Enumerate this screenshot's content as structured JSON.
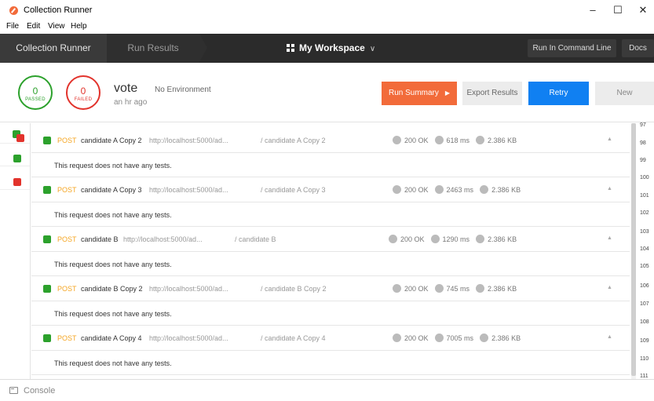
{
  "window": {
    "title": "Collection Runner",
    "minimize": "–",
    "maximize": "☐",
    "close": "✕"
  },
  "menu": [
    "File",
    "Edit",
    "View",
    "Help"
  ],
  "nav": {
    "tab1": "Collection Runner",
    "tab2": "Run Results",
    "workspace": "My Workspace",
    "workspace_chevron": "∨",
    "command_line": "Run In Command Line",
    "docs": "Docs"
  },
  "summary": {
    "passed_count": "0",
    "passed_label": "PASSED",
    "failed_count": "0",
    "failed_label": "FAILED",
    "run_name": "vote",
    "environment": "No Environment",
    "time_ago": "an hr ago"
  },
  "actions": {
    "run_summary": "Run Summary",
    "run_summary_arrow": "▶",
    "export": "Export Results",
    "retry": "Retry",
    "new": "New"
  },
  "requests": [
    {
      "method": "POST",
      "name": "candidate A Copy 2",
      "url": "http://localhost:5000/ad...",
      "path": "/ candidate A Copy 2",
      "status": "200 OK",
      "time": "618 ms",
      "size": "2.386 KB",
      "test_message": "This request does not have any tests."
    },
    {
      "method": "POST",
      "name": "candidate A Copy 3",
      "url": "http://localhost:5000/ad...",
      "path": "/ candidate A Copy 3",
      "status": "200 OK",
      "time": "2463 ms",
      "size": "2.386 KB",
      "test_message": "This request does not have any tests."
    },
    {
      "method": "POST",
      "name": "candidate B",
      "url": "http://localhost:5000/ad...",
      "path": "/ candidate B",
      "status": "200 OK",
      "time": "1290 ms",
      "size": "2.386 KB",
      "test_message": "This request does not have any tests."
    },
    {
      "method": "POST",
      "name": "candidate B Copy 2",
      "url": "http://localhost:5000/ad...",
      "path": "/ candidate B Copy 2",
      "status": "200 OK",
      "time": "745 ms",
      "size": "2.386 KB",
      "test_message": "This request does not have any tests."
    },
    {
      "method": "POST",
      "name": "candidate A Copy 4",
      "url": "http://localhost:5000/ad...",
      "path": "/ candidate A Copy 4",
      "status": "200 OK",
      "time": "7005 ms",
      "size": "2.386 KB",
      "test_message": "This request does not have any tests."
    }
  ],
  "line_numbers": [
    "97",
    "98",
    "99",
    "100",
    "101",
    "102",
    "103",
    "104",
    "105",
    "106",
    "107",
    "108",
    "109",
    "110",
    "111"
  ],
  "console": {
    "label": "Console"
  },
  "colors": {
    "accent": "#f26b3a",
    "pass": "#2ca12c",
    "fail": "#e2332c",
    "primary": "#1080f2",
    "nav_bg": "#2b2b2b"
  }
}
